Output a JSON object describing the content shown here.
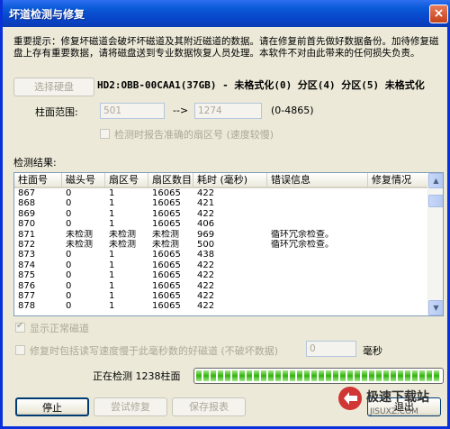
{
  "window": {
    "title": "坏道检测与修复",
    "close_glyph": "×"
  },
  "notice": "重要提示：修复坏磁道会破坏坏磁道及其附近磁道的数据。请在修复前首先做好数据备份。加待修复磁盘上存有重要数据，请将磁盘送到专业数据恢复人员处理。本软件不对由此带来的任何损失负责。",
  "disk": {
    "select_button": "选择硬盘",
    "info": "HD2:OBB-00CAA1(37GB) - 未格式化(0) 分区(4) 分区(5) 未格式化"
  },
  "range": {
    "label": "柱面范围:",
    "start": "501",
    "arrow": "-->",
    "end": "1274",
    "hint": "(0-4865)"
  },
  "report_sector_checkbox": {
    "label": "检测时报告准确的扇区号 (速度较慢)",
    "checked": false
  },
  "results": {
    "label": "检测结果:",
    "columns": [
      "柱面号",
      "磁头号",
      "扇区号",
      "扇区数目",
      "耗时 (毫秒)",
      "错误信息",
      "修复情况"
    ],
    "rows": [
      [
        "867",
        "0",
        "1",
        "16065",
        "422",
        "",
        ""
      ],
      [
        "868",
        "0",
        "1",
        "16065",
        "421",
        "",
        ""
      ],
      [
        "869",
        "0",
        "1",
        "16065",
        "422",
        "",
        ""
      ],
      [
        "870",
        "0",
        "1",
        "16065",
        "406",
        "",
        ""
      ],
      [
        "871",
        "未检测",
        "未检测",
        "未检测",
        "969",
        "循环冗余检查。",
        ""
      ],
      [
        "872",
        "未检测",
        "未检测",
        "未检测",
        "500",
        "循环冗余检查。",
        ""
      ],
      [
        "873",
        "0",
        "1",
        "16065",
        "438",
        "",
        ""
      ],
      [
        "874",
        "0",
        "1",
        "16065",
        "422",
        "",
        ""
      ],
      [
        "875",
        "0",
        "1",
        "16065",
        "422",
        "",
        ""
      ],
      [
        "876",
        "0",
        "1",
        "16065",
        "422",
        "",
        ""
      ],
      [
        "877",
        "0",
        "1",
        "16065",
        "422",
        "",
        ""
      ],
      [
        "878",
        "0",
        "1",
        "16065",
        "422",
        "",
        ""
      ]
    ]
  },
  "show_normal_checkbox": {
    "label": "显示正常磁道",
    "checked": true
  },
  "repair_slow_checkbox": {
    "label": "修复时包括读写速度慢于此毫秒数的好磁道 (不破坏数据)",
    "checked": false,
    "value": "0",
    "unit": "毫秒"
  },
  "status": {
    "text": "正在检测 1238柱面",
    "progress": 0.99
  },
  "buttons": {
    "stop": "停止",
    "try_repair": "尝试修复",
    "save_report": "保存报表",
    "exit": "退出"
  },
  "watermark": {
    "text": "极速下载站",
    "sub": "JISUXZ.COM"
  }
}
